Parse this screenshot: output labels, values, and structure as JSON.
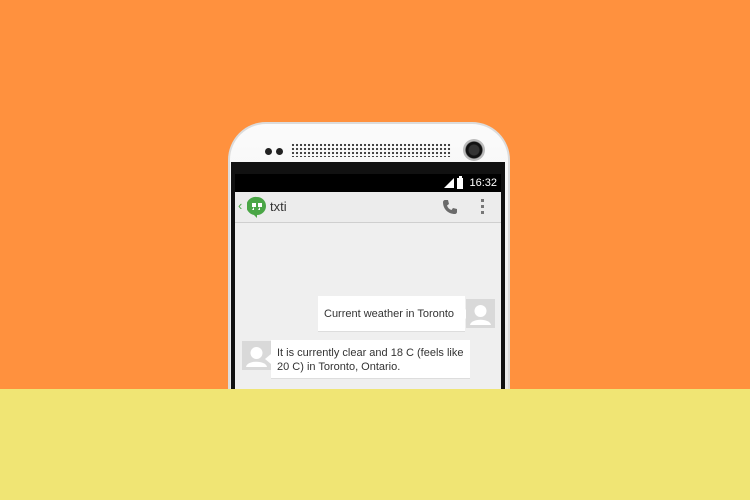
{
  "colors": {
    "background_top": "#ff913e",
    "background_bottom": "#f0e574",
    "accent_green": "#4aa646"
  },
  "status_bar": {
    "time": "16:32",
    "icons": [
      "signal-icon",
      "battery-icon"
    ]
  },
  "app_bar": {
    "title": "txti",
    "icons": [
      "back-icon",
      "hangouts-logo-icon",
      "phone-icon",
      "overflow-menu-icon"
    ]
  },
  "messages": [
    {
      "direction": "outgoing",
      "text": "Current weather in Toronto",
      "avatar": "default-avatar-icon"
    },
    {
      "direction": "incoming",
      "text": "It is currently clear and 18 C (feels like 20 C) in Toronto, Ontario.",
      "avatar": "default-avatar-icon"
    }
  ]
}
